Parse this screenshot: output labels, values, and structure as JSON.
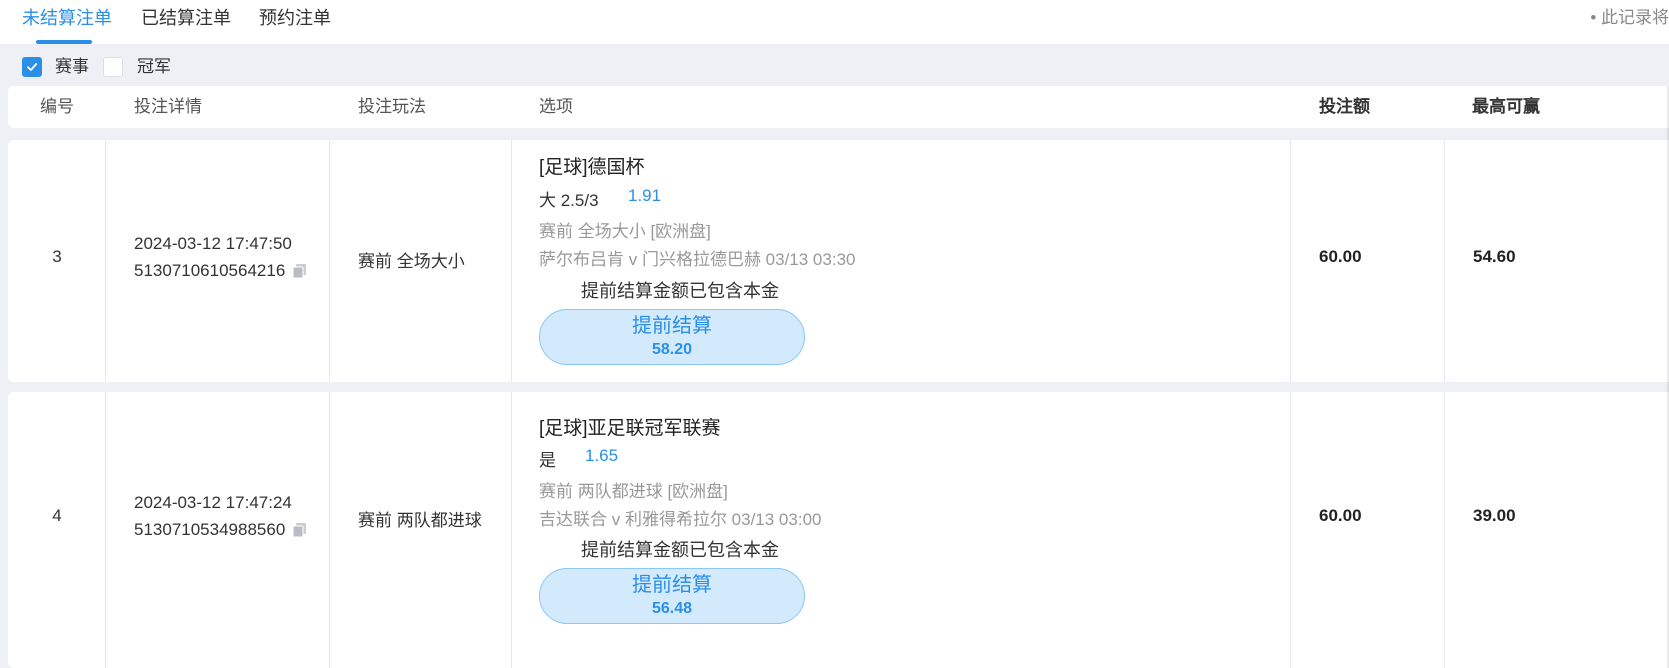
{
  "tabs": [
    {
      "label": "未结算注单",
      "active": true
    },
    {
      "label": "已结算注单",
      "active": false
    },
    {
      "label": "预约注单",
      "active": false
    }
  ],
  "notice": "• 此记录将",
  "filters": [
    {
      "label": "赛事",
      "checked": true
    },
    {
      "label": "冠军",
      "checked": false
    }
  ],
  "columns": {
    "id": "编号",
    "detail": "投注详情",
    "play": "投注玩法",
    "option": "选项",
    "stake": "投注额",
    "max_win": "最高可赢"
  },
  "rows": [
    {
      "id": "3",
      "time": "2024-03-12 17:47:50",
      "order_no": "5130710610564216",
      "play": "赛前 全场大小",
      "league": "[足球]德国杯",
      "pick": "大 2.5/3",
      "odds": "1.91",
      "market": "赛前   全场大小   [欧洲盘]",
      "match": "萨尔布吕肯 v 门兴格拉德巴赫     03/13 03:30",
      "cashout_note": "提前结算金额已包含本金",
      "cashout_label": "提前结算",
      "cashout_amount": "58.20",
      "stake": "60.00",
      "max_win": "54.60"
    },
    {
      "id": "4",
      "time": "2024-03-12 17:47:24",
      "order_no": "5130710534988560",
      "play": "赛前 两队都进球",
      "league": "[足球]亚足联冠军联赛",
      "pick": "是",
      "odds": "1.65",
      "market": "赛前   两队都进球   [欧洲盘]",
      "match": "吉达联合 v 利雅得希拉尔     03/13 03:00",
      "cashout_note": "提前结算金额已包含本金",
      "cashout_label": "提前结算",
      "cashout_amount": "56.48",
      "stake": "60.00",
      "max_win": "39.00"
    }
  ],
  "colors": {
    "accent": "#2b8fe8",
    "background": "#eef0f5",
    "cashout_bg": "#d3eafc"
  }
}
